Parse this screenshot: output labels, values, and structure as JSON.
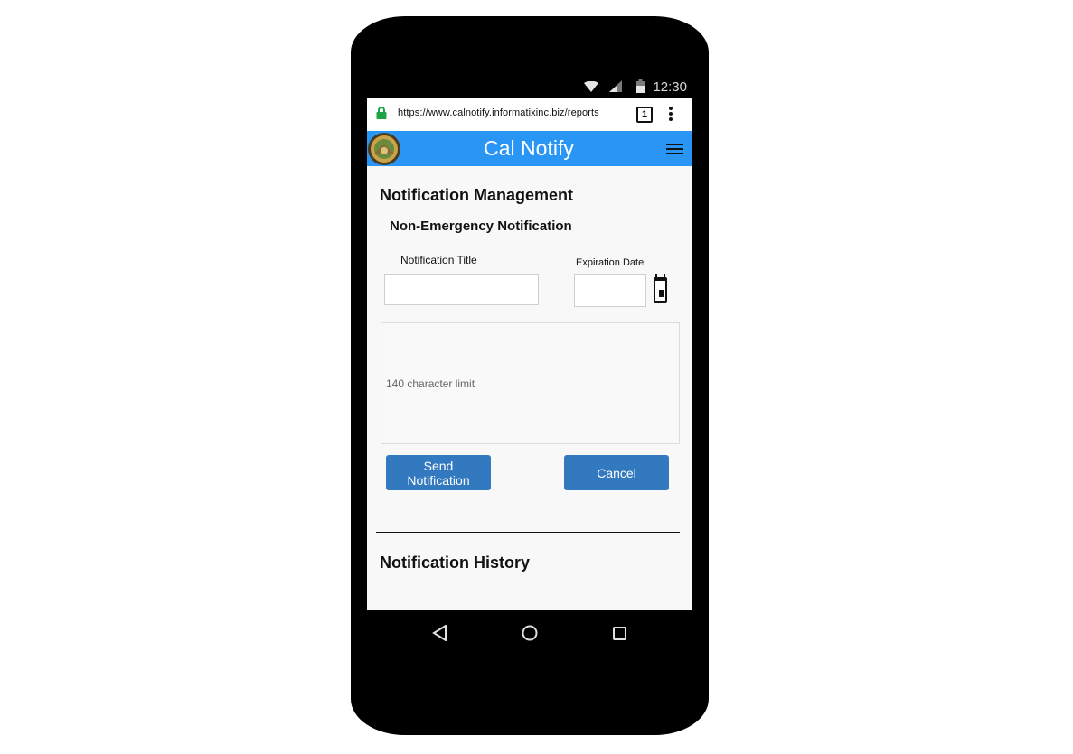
{
  "status_bar": {
    "time": "12:30",
    "icons": [
      "wifi-icon",
      "signal-icon",
      "battery-icon"
    ]
  },
  "browser": {
    "url": "https://www.calnotify.informatixinc.biz/reports",
    "tab_count": "1",
    "icons": [
      "lock-icon",
      "tabs-icon",
      "more-options-icon"
    ],
    "lock_color": "#1ea446"
  },
  "app_header": {
    "title": "Cal Notify",
    "color": "#2996f5",
    "icons": [
      "state-seal-logo",
      "hamburger-menu-icon"
    ]
  },
  "main": {
    "section_title": "Notification Management",
    "subsection_title": "Non-Emergency Notification",
    "notification_title_label": "Notification Title",
    "notification_title_value": "",
    "expiration_date_label": "Expiration Date",
    "expiration_date_value": "",
    "message_placeholder": "140 character limit",
    "send_button_label": "Send Notification",
    "cancel_button_label": "Cancel",
    "button_color": "#3379c0",
    "history_title": "Notification History"
  },
  "nav_bar": {
    "icons": [
      "back-icon",
      "home-icon",
      "recents-icon"
    ]
  }
}
